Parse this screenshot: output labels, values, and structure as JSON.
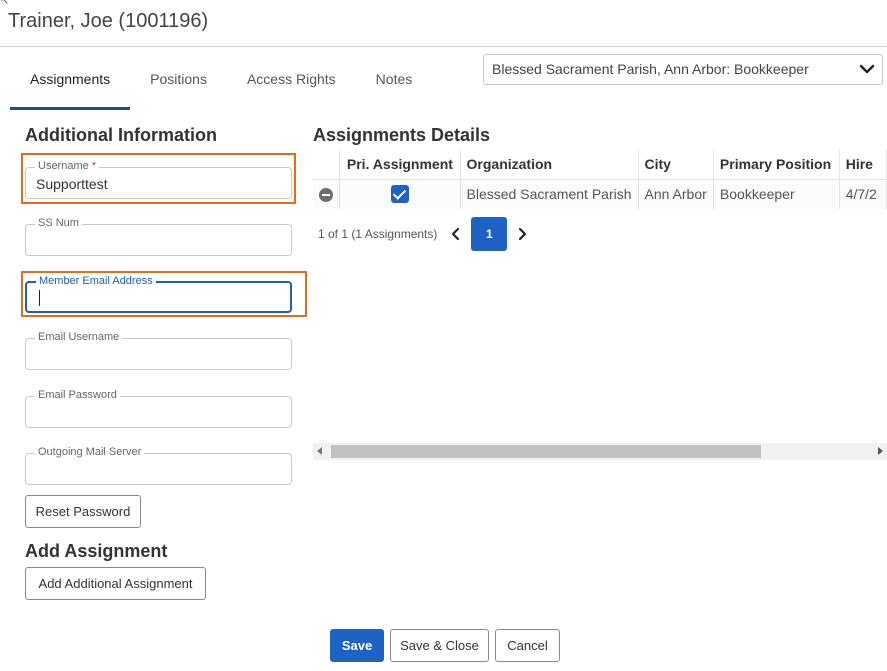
{
  "window": {
    "title": "Trainer, Joe (1001196)"
  },
  "tabs": [
    {
      "label": "Assignments",
      "active": true
    },
    {
      "label": "Positions",
      "active": false
    },
    {
      "label": "Access Rights",
      "active": false
    },
    {
      "label": "Notes",
      "active": false
    }
  ],
  "assignment_select": {
    "value": "Blessed Sacrament Parish, Ann Arbor: Bookkeeper",
    "icon": "chevron-down-icon"
  },
  "additional_info": {
    "heading": "Additional Information",
    "username": {
      "label": "Username",
      "required_mark": "*",
      "value": "Supporttest"
    },
    "ss_num": {
      "label": "SS Num",
      "value": ""
    },
    "member_email": {
      "label": "Member Email Address",
      "value": ""
    },
    "email_username": {
      "label": "Email Username",
      "value": ""
    },
    "email_password": {
      "label": "Email Password",
      "value": ""
    },
    "outgoing_mail": {
      "label": "Outgoing Mail Server",
      "value": ""
    },
    "reset_password_label": "Reset Password"
  },
  "add_assignment": {
    "heading": "Add Assignment",
    "button_label": "Add Additional Assignment"
  },
  "details": {
    "heading": "Assignments Details",
    "columns": [
      "",
      "Pri. Assignment",
      "Organization",
      "City",
      "Primary Position",
      "Hire"
    ],
    "rows": [
      {
        "primary": true,
        "organization": "Blessed Sacrament Parish",
        "city": "Ann Arbor",
        "position": "Bookkeeper",
        "hire": "4/7/2"
      }
    ],
    "pager": {
      "summary": "1 of 1 (1 Assignments)",
      "current_page": "1"
    }
  },
  "footer": {
    "save": "Save",
    "save_close": "Save & Close",
    "cancel": "Cancel"
  },
  "colors": {
    "accent": "#1e63c4",
    "highlight": "#e86a1c",
    "tab_underline": "#1b4f8a"
  }
}
